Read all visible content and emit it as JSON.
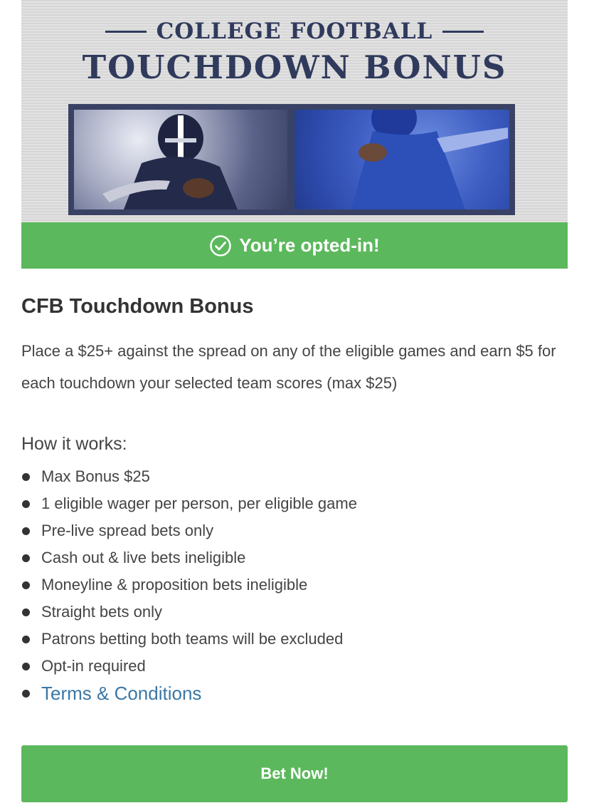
{
  "banner": {
    "line1": "COLLEGE FOOTBALL",
    "line2": "TOUCHDOWN BONUS",
    "title_color": "#2f3a5c"
  },
  "optin": {
    "status_text": "You’re opted-in!",
    "icon": "check-circle-icon",
    "color": "#5cb85c"
  },
  "promo": {
    "title": "CFB Touchdown Bonus",
    "description": "Place a $25+ against the spread on any of the eligible games and earn $5 for each touchdown your selected team scores (max $25)"
  },
  "how_it_works": {
    "title": "How it works:",
    "items": [
      "Max Bonus $25",
      "1 eligible wager per person, per eligible game",
      "Pre-live spread bets only",
      "Cash out & live bets ineligible",
      "Moneyline & proposition bets ineligible",
      "Straight bets only",
      "Patrons betting both teams will be excluded",
      "Opt-in required"
    ],
    "terms_link": "Terms & Conditions",
    "link_color": "#3b77a5"
  },
  "actions": {
    "bet_now_label": "Bet Now!",
    "button_color": "#5cb85c"
  }
}
